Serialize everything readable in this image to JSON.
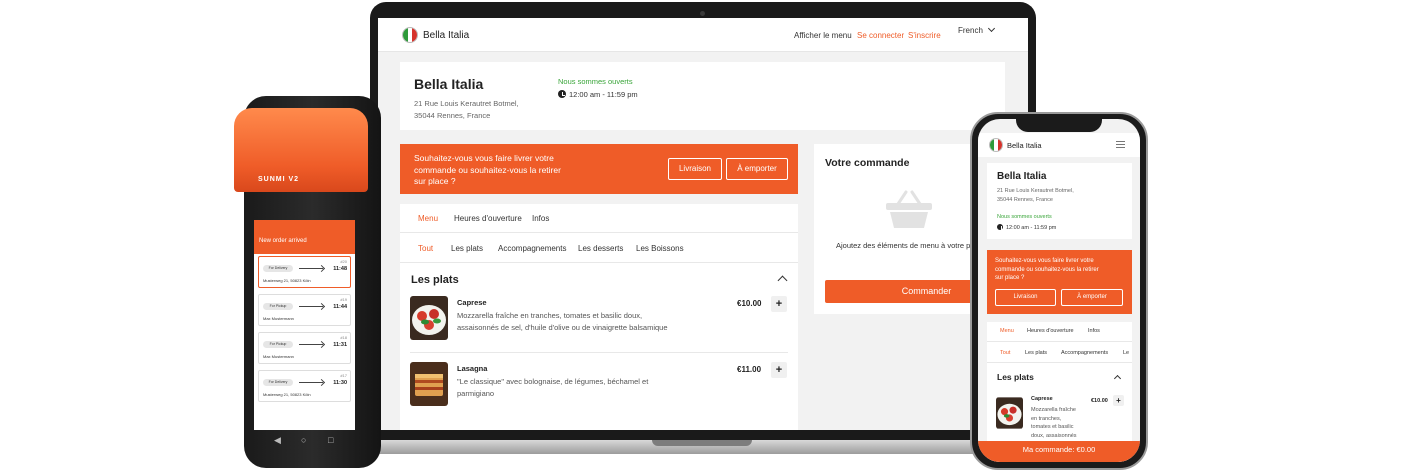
{
  "brand": {
    "name": "Bella Italia",
    "accent": "#ef5c28",
    "open_color": "#3aa53a"
  },
  "header": {
    "view_menu": "Afficher le menu",
    "login": "Se connecter",
    "signup": "S'inscrire",
    "language": "French"
  },
  "restaurant": {
    "name": "Bella Italia",
    "address_line1": "21 Rue Louis Kerautret Botmel,",
    "address_line2": "35044 Rennes, France",
    "status": "Nous sommes ouverts",
    "hours": "12:00 am - 11:59 pm"
  },
  "delivery_banner": {
    "question_l1": "Souhaitez-vous vous faire livrer votre",
    "question_l2": "commande ou souhaitez-vous la retirer",
    "question_l3": "sur place ?",
    "delivery_label": "Livraison",
    "pickup_label": "À emporter"
  },
  "tabs": [
    "Menu",
    "Heures d'ouverture",
    "Infos"
  ],
  "categories": [
    "Tout",
    "Les plats",
    "Accompagnements",
    "Les desserts",
    "Les Boissons"
  ],
  "section_title": "Les plats",
  "dishes": [
    {
      "name": "Caprese",
      "desc_l1": "Mozzarella fraîche en tranches, tomates et basilic doux,",
      "desc_l2": "assaisonnés de sel, d'huile d'olive ou de vinaigrette balsamique",
      "price": "€10.00"
    },
    {
      "name": "Lasagna",
      "desc_l1": "\"Le classique\" avec bolognaise, de légumes, béchamel et",
      "desc_l2": "parmigiano",
      "price": "€11.00"
    }
  ],
  "order": {
    "title": "Votre commande",
    "hint": "Ajoutez des éléments de menu à votre pa",
    "cta": "Commander"
  },
  "pos": {
    "brand": "SUNMI V2",
    "title": "New order arrived",
    "orders": [
      {
        "num": "#20",
        "time": "11:48",
        "type": "For Delivery",
        "addr": "Musterweg 21, 50823 Köln"
      },
      {
        "num": "#19",
        "time": "11:44",
        "type": "For Pickup",
        "addr": "Max Mustermann"
      },
      {
        "num": "#18",
        "time": "11:31",
        "type": "For Pickup",
        "addr": "Max Mustermann"
      },
      {
        "num": "#17",
        "time": "11:30",
        "type": "For Delivery",
        "addr": "Musterweg 21, 50823 Köln"
      }
    ],
    "nav": [
      "◀",
      "○",
      "□"
    ]
  },
  "phone": {
    "q_l1": "Souhaitez-vous vous faire livrer votre",
    "q_l2": "commande ou souhaitez-vous la retirer",
    "q_l3": "sur place ?",
    "caprese_desc_l1": "Mozzarella fraîche",
    "caprese_desc_l2": "en tranches,",
    "caprese_desc_l3": "tomates et basilic",
    "caprese_desc_l4": "doux, assaisonnés",
    "cat_partial": "Le",
    "bottom_bar": "Ma commande: €0.00"
  }
}
